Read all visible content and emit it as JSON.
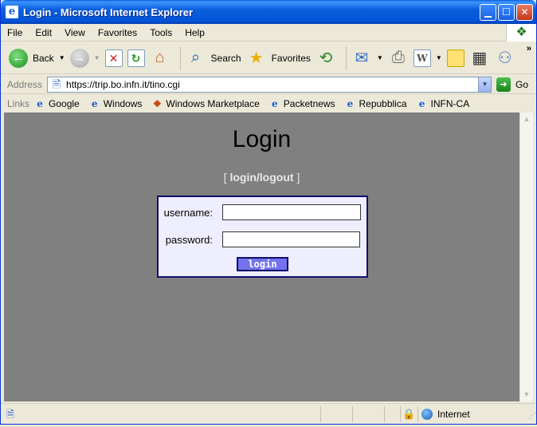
{
  "window": {
    "title": "Login - Microsoft Internet Explorer",
    "icon": "ie-page-icon"
  },
  "menu": [
    "File",
    "Edit",
    "View",
    "Favorites",
    "Tools",
    "Help"
  ],
  "toolbar": {
    "back": "Back",
    "search": "Search",
    "favorites": "Favorites"
  },
  "address": {
    "label": "Address",
    "url": "https://trip.bo.infn.it/tino.cgi",
    "go": "Go"
  },
  "links": {
    "label": "Links",
    "items": [
      "Google",
      "Windows",
      "Windows Marketplace",
      "Packetnews",
      "Repubblica",
      "INFN-CA"
    ]
  },
  "page": {
    "title": "Login",
    "bracket_open": "[",
    "nav_link": "login/logout",
    "bracket_close": "]",
    "username_label": "username:",
    "username_value": "",
    "password_label": "password:",
    "password_value": "",
    "login_button": "login"
  },
  "status": {
    "text": "",
    "zone": "Internet"
  },
  "colors": {
    "page_background": "#808080",
    "form_background": "#eeeeff",
    "form_border": "#10106a",
    "button_background": "#7373f0"
  }
}
